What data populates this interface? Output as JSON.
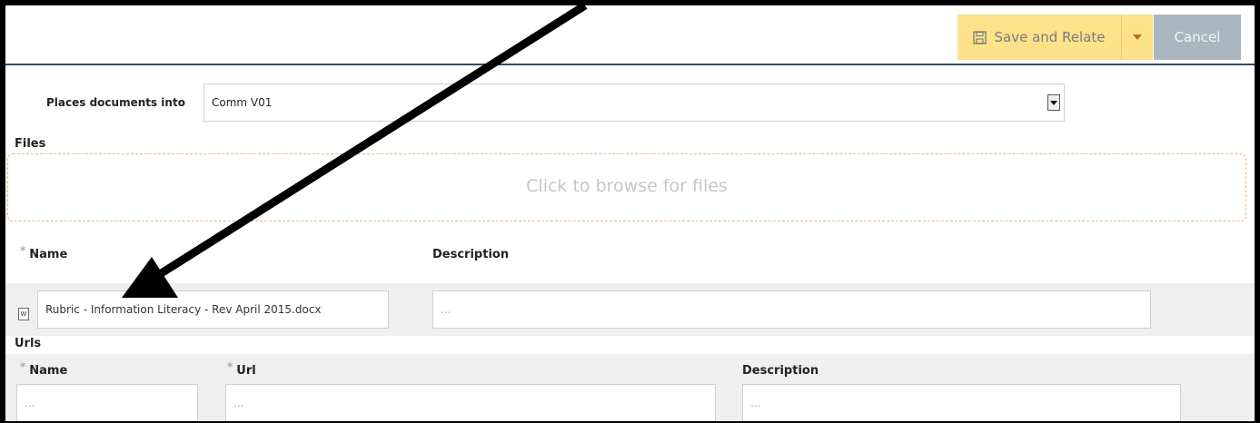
{
  "toolbar": {
    "save_label": "Save and Relate",
    "cancel_label": "Cancel",
    "save_icon": "save-icon",
    "dropdown_icon": "chevron-down-icon"
  },
  "places": {
    "label": "Places documents into",
    "value": "Comm V01"
  },
  "files": {
    "heading": "Files",
    "dropzone_text": "Click to browse for files",
    "columns": {
      "name": "Name",
      "description": "Description"
    },
    "required_mark": "*",
    "row": {
      "icon": "word-document-icon",
      "name_value": "Rubric - Information Literacy - Rev April 2015.docx",
      "description_placeholder": "..."
    }
  },
  "urls": {
    "heading": "Urls",
    "columns": {
      "name": "Name",
      "url": "Url",
      "description": "Description"
    },
    "required_mark": "*",
    "row": {
      "name_placeholder": "...",
      "url_placeholder": "...",
      "description_placeholder": "..."
    }
  },
  "colors": {
    "save_button_bg": "#fde28a",
    "cancel_button_bg": "#a9b7c1",
    "toolbar_border": "#2b4a6b",
    "dropzone_border": "#e0b98c"
  }
}
